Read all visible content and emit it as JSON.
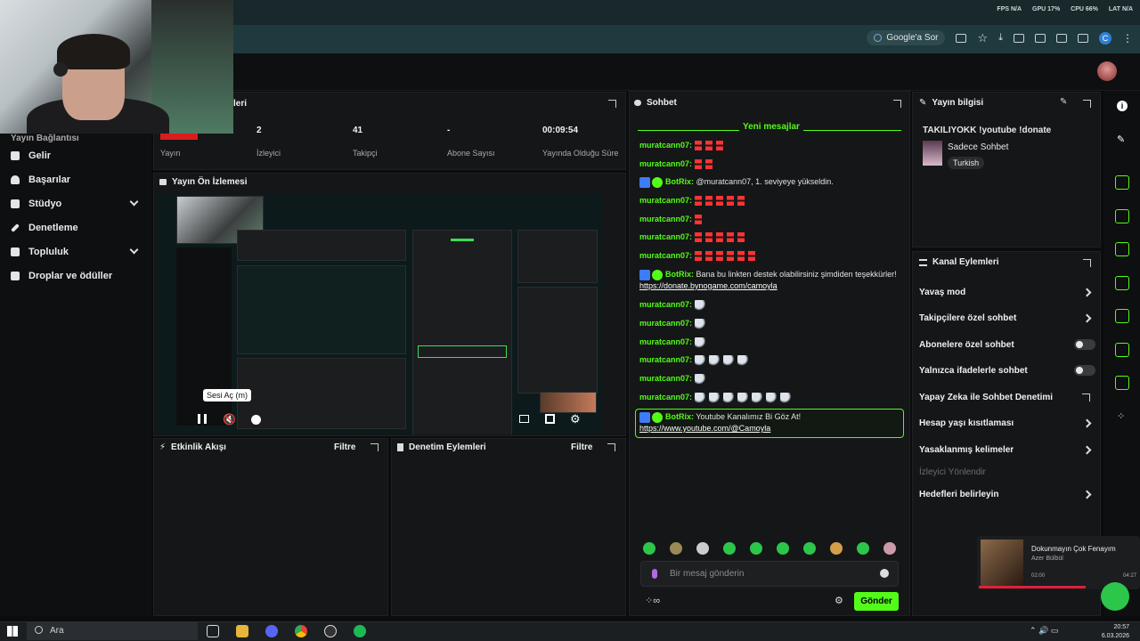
{
  "perf": {
    "fps": "FPS N/A",
    "gpu": "GPU 17%",
    "cpu": "CPU 66%",
    "lat": "LAT N/A"
  },
  "browser": {
    "google_chip": "Google'a Sor",
    "profile_letter": "C"
  },
  "nav": {
    "partial_top_label": "Yayın Bağlantısı",
    "items": [
      {
        "label": "Gelir",
        "chevron": false
      },
      {
        "label": "Başarılar",
        "chevron": false
      },
      {
        "label": "Stüdyo",
        "chevron": true
      },
      {
        "label": "Denetleme",
        "chevron": false
      },
      {
        "label": "Topluluk",
        "chevron": true
      },
      {
        "label": "Droplar ve ödüller",
        "chevron": false
      }
    ]
  },
  "stats": {
    "header_partial": "leri",
    "stream_label": "Yayın",
    "viewers": {
      "value": "2",
      "label": "İzleyici"
    },
    "followers": {
      "value": "41",
      "label": "Takipçi"
    },
    "subs": {
      "value": "-",
      "label": "Abone Sayısı"
    },
    "uptime": {
      "value": "00:09:54",
      "label": "Yayında Olduğu Süre"
    }
  },
  "preview": {
    "title": "Yayın Ön İzlemesi",
    "tooltip": "Sesi Aç (m)"
  },
  "activity": {
    "title": "Etkinlik Akışı",
    "filter": "Filtre"
  },
  "moderation": {
    "title": "Denetim Eylemleri",
    "filter": "Filtre"
  },
  "chat": {
    "title": "Sohbet",
    "new_messages": "Yeni mesajlar",
    "messages": [
      {
        "user": "muratcann07:",
        "text": "",
        "emotes": "red",
        "count": 3
      },
      {
        "user": "muratcann07:",
        "text": "",
        "emotes": "red",
        "count": 2
      },
      {
        "user": "BotRix:",
        "text": "@muratcann07, 1. seviyeye yükseldin.",
        "bot": true
      },
      {
        "user": "muratcann07:",
        "text": "",
        "emotes": "red",
        "count": 5
      },
      {
        "user": "muratcann07:",
        "text": "",
        "emotes": "red",
        "count": 1
      },
      {
        "user": "muratcann07:",
        "text": "",
        "emotes": "red",
        "count": 5
      },
      {
        "user": "muratcann07:",
        "text": "",
        "emotes": "red",
        "count": 6
      },
      {
        "user": "BotRix:",
        "text": "Bana bu linkten destek olabilirsiniz şimdiden teşekkürler!",
        "link": "https://donate.bynogame.com/camoyla",
        "bot": true
      },
      {
        "user": "muratcann07:",
        "text": "",
        "emotes": "bird",
        "count": 1
      },
      {
        "user": "muratcann07:",
        "text": "",
        "emotes": "bird",
        "count": 1
      },
      {
        "user": "muratcann07:",
        "text": "",
        "emotes": "bird",
        "count": 1
      },
      {
        "user": "muratcann07:",
        "text": "",
        "emotes": "bird",
        "count": 4
      },
      {
        "user": "muratcann07:",
        "text": "",
        "emotes": "bird",
        "count": 1
      },
      {
        "user": "muratcann07:",
        "text": "",
        "emotes": "bird",
        "count": 7
      }
    ],
    "pinned": {
      "user": "BotRix:",
      "text": "Youtube Kanalımız Bi Göz At!",
      "link": "https://www.youtube.com/@Camoyla"
    },
    "input_placeholder": "Bir mesaj gönderin",
    "send": "Gönder"
  },
  "stream_info": {
    "title": "Yayın bilgisi",
    "stream_title": "TAKILIYOKK !youtube !donate",
    "category": "Sadece Sohbet",
    "tag": "Turkish"
  },
  "channel_actions": {
    "title": "Kanal Eylemleri",
    "rows": [
      {
        "label": "Yavaş mod",
        "type": "chevron"
      },
      {
        "label": "Takipçilere özel sohbet",
        "type": "chevron"
      },
      {
        "label": "Abonelere özel sohbet",
        "type": "toggle"
      },
      {
        "label": "Yalnızca ifadelerle sohbet",
        "type": "toggle"
      },
      {
        "label": "Yapay Zeka ile Sohbet Denetimi",
        "type": "external"
      },
      {
        "label": "Hesap yaşı kısıtlaması",
        "type": "chevron"
      },
      {
        "label": "Yasaklanmış kelimeler",
        "type": "chevron"
      },
      {
        "label": "İzleyici Yönlendir",
        "type": "disabled"
      },
      {
        "label": "Hedefleri belirleyin",
        "type": "chevron"
      }
    ]
  },
  "now_playing": {
    "song": "Dokunmayın Çok Fenayım",
    "artist": "Azer Bülbül",
    "elapsed": "02:00",
    "duration": "04:27"
  },
  "taskbar": {
    "search": "Ara",
    "time": "20:57",
    "date": "6.03.2026"
  },
  "colors": {
    "accent": "#53fc18",
    "bg": "#0e0f10",
    "panel": "#151617"
  }
}
